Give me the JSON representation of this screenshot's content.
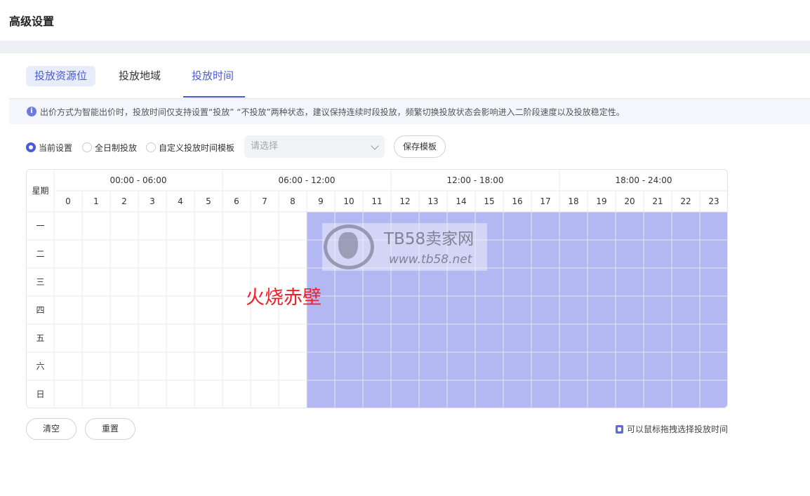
{
  "page_title": "高级设置",
  "tabs": [
    {
      "label": "投放资源位",
      "style": "pill"
    },
    {
      "label": "投放地域",
      "style": "plain"
    },
    {
      "label": "投放时间",
      "style": "active"
    }
  ],
  "notice": {
    "text": "出价方式为智能出价时，投放时间仅支持设置“投放”  “不投放”两种状态，建议保持连续时段投放，频繁切换投放状态会影响进入二阶段速度以及投放稳定性。"
  },
  "options": {
    "radios": [
      {
        "label": "当前设置",
        "checked": true
      },
      {
        "label": "全日制投放",
        "checked": false
      },
      {
        "label": "自定义投放时间模板",
        "checked": false
      }
    ],
    "select_placeholder": "请选择",
    "save_template_label": "保存模板"
  },
  "schedule": {
    "corner_label": "星期",
    "ranges": [
      "00:00 - 06:00",
      "06:00 - 12:00",
      "12:00 - 18:00",
      "18:00 - 24:00"
    ],
    "hours": [
      "0",
      "1",
      "2",
      "3",
      "4",
      "5",
      "6",
      "7",
      "8",
      "9",
      "10",
      "11",
      "12",
      "13",
      "14",
      "15",
      "16",
      "17",
      "18",
      "19",
      "20",
      "21",
      "22",
      "23"
    ],
    "days": [
      "一",
      "二",
      "三",
      "四",
      "五",
      "六",
      "日"
    ],
    "active_from_hour": 9,
    "active_to_hour": 23,
    "active_color": "#b3b8f3",
    "line_color": "#e6e8ec"
  },
  "buttons": {
    "clear_label": "清空",
    "reset_label": "重置"
  },
  "hint_text": "可以鼠标拖拽选择投放时间",
  "watermark": {
    "title": "TB58卖家网",
    "url": "www.tb58.net"
  },
  "overlay_text": "火烧赤壁",
  "colors": {
    "accent": "#4a5bd5",
    "overlay": "#f0202c"
  }
}
